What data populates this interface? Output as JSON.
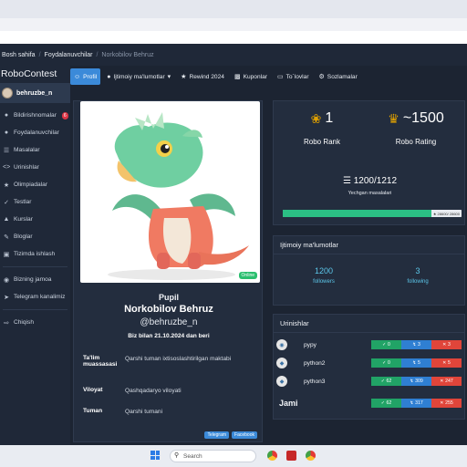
{
  "breadcrumb": [
    "Bosh sahifa",
    "Foydalanuvchilar",
    "Norkobilov Behruz"
  ],
  "sidebar": {
    "brand": "RoboContest",
    "username": "behruzbe_n",
    "items": [
      {
        "label": "Bildirishnomalar",
        "icon": "bell-icon",
        "badge": "6"
      },
      {
        "label": "Foydalanuvchilar",
        "icon": "users-icon"
      },
      {
        "label": "Masalalar",
        "icon": "list-icon"
      },
      {
        "label": "Urinishlar",
        "icon": "code-icon"
      },
      {
        "label": "Olimpiadalar",
        "icon": "trophy-icon"
      },
      {
        "label": "Testlar",
        "icon": "check-icon"
      },
      {
        "label": "Kurslar",
        "icon": "graduation-icon"
      },
      {
        "label": "Bloglar",
        "icon": "pen-icon"
      },
      {
        "label": "Tizimda ishlash",
        "icon": "book-icon"
      }
    ],
    "extra": [
      {
        "label": "Bizning jamoa",
        "icon": "team-icon"
      },
      {
        "label": "Telegram kanalimiz",
        "icon": "telegram-icon"
      }
    ],
    "logout": "Chiqish"
  },
  "tabs": [
    {
      "label": "Profil",
      "icon": "user-circle-icon",
      "active": true
    },
    {
      "label": "Ijtimoiy ma'lumotlar",
      "icon": "users-icon",
      "dropdown": true
    },
    {
      "label": "Rewind 2024",
      "icon": "star-icon"
    },
    {
      "label": "Kuponlar",
      "icon": "ticket-icon"
    },
    {
      "label": "To`lovlar",
      "icon": "card-icon"
    },
    {
      "label": "Sozlamalar",
      "icon": "gear-icon"
    }
  ],
  "profile": {
    "online": "Online",
    "rank": "Pupil",
    "fullname": "Norkobilov Behruz",
    "handle": "@behruzbe_n",
    "since": "Biz bilan 21.10.2024 dan beri",
    "info": [
      {
        "key": "Ta'lim muassasasi",
        "value": "Qarshi tuman ixtisoslashtirilgan maktabi"
      },
      {
        "key": "Viloyat",
        "value": "Qashqadaryo viloyati"
      },
      {
        "key": "Tuman",
        "value": "Qarshi tumani"
      }
    ],
    "social": [
      "Telegram",
      "Facebook"
    ]
  },
  "stats": {
    "rank_value": "1",
    "rank_label": "Robo Rank",
    "rating_value": "~1500",
    "rating_label": "Robo Rating",
    "solved": "1200/1212",
    "solved_label": "Yechgan masalalari",
    "progress_fraction": 0.99,
    "progress_tag": "28600/ 28600"
  },
  "social_stats": {
    "title": "Ijtimoiy ma'lumotlar",
    "followers": "1200",
    "followers_label": "followers",
    "following": "3",
    "following_label": "following"
  },
  "attempts": {
    "title": "Urinishlar",
    "rows": [
      {
        "lang": "pypy",
        "ok": "0",
        "wrong": "3",
        "err": "3"
      },
      {
        "lang": "python2",
        "ok": "0",
        "wrong": "5",
        "err": "5"
      },
      {
        "lang": "python3",
        "ok": "62",
        "wrong": "309",
        "err": "247"
      }
    ],
    "total_label": "Jami",
    "total": {
      "ok": "62",
      "wrong": "317",
      "err": "255"
    }
  },
  "taskbar": {
    "search_placeholder": "Search"
  },
  "colors": {
    "accent": "#3b8ad9",
    "success": "#21a366",
    "danger": "#e0453a",
    "gold": "#e0a100"
  }
}
